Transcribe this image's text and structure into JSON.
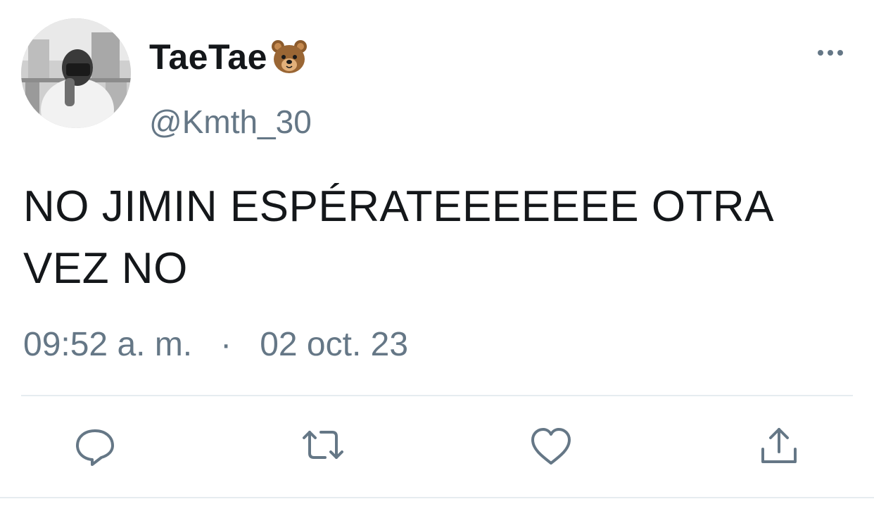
{
  "tweet": {
    "author": {
      "display_name": "TaeTae",
      "emoji_icon": "bear-face-icon",
      "handle": "@Kmth_30"
    },
    "text": "NO JIMIN ESPÉRATEEEEEEE OTRA VEZ NO",
    "time": "09:52 a. m.",
    "separator": "·",
    "date": "02 oct. 23"
  },
  "icons": {
    "more": "more-dots-icon",
    "reply": "reply-bubble-icon",
    "retweet": "retweet-icon",
    "like": "heart-icon",
    "share": "share-upload-icon"
  },
  "colors": {
    "text_primary": "#14171a",
    "text_secondary": "#657786",
    "divider": "#e6ecf0",
    "icon": "#657786"
  }
}
